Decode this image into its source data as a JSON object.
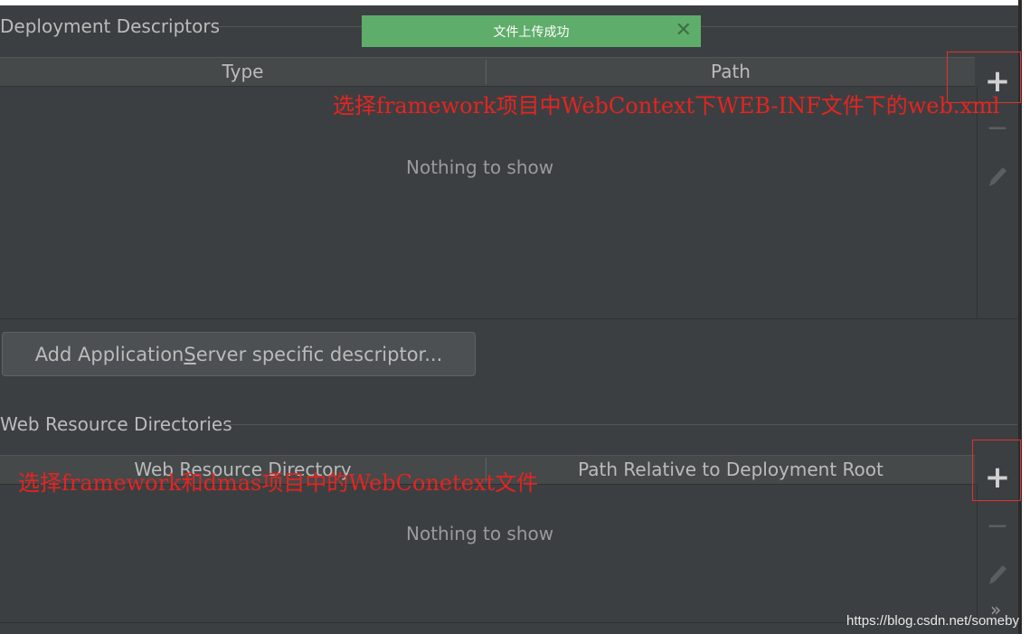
{
  "deployment": {
    "title": "Deployment Descriptors",
    "col_type": "Type",
    "col_path": "Path",
    "empty": "Nothing to show"
  },
  "toast": {
    "message": "文件上传成功",
    "close": "✕"
  },
  "annotations": {
    "descriptor_hint": "选择framework项目中WebContext下WEB-INF文件下的web.xml",
    "resource_hint": "选择framework和dmas项目中的WebConetext文件"
  },
  "app_server_button": {
    "before": "Add Application ",
    "mnemonic": "S",
    "after": "erver specific descriptor..."
  },
  "web_resources": {
    "title": "Web Resource Directories",
    "col_dir": "Web Resource Directory",
    "col_rel": "Path Relative to Deployment Root",
    "empty": "Nothing to show"
  },
  "toolbar": {
    "add": "+",
    "remove": "−",
    "more": "»"
  },
  "watermark": "https://blog.csdn.net/someby",
  "colors": {
    "background": "#3c3f41",
    "toast": "#5fad6a",
    "annotation": "#e52420"
  }
}
